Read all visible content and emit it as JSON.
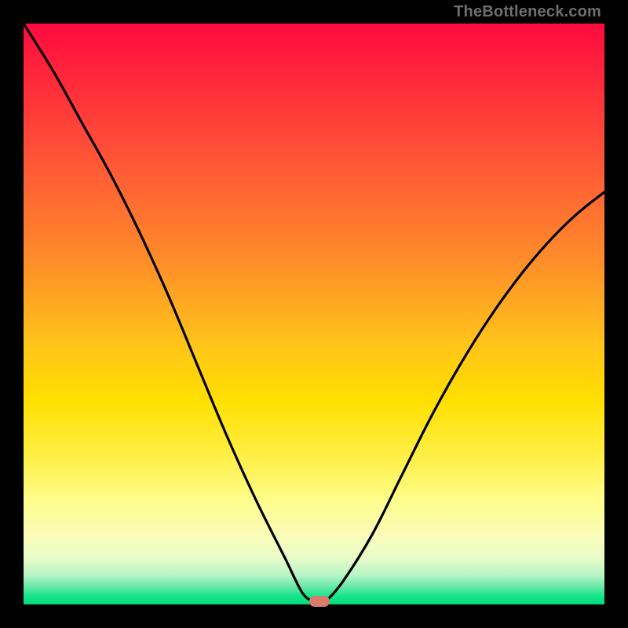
{
  "watermark": "TheBottleneck.com",
  "colors": {
    "frame_bg": "#000000",
    "gradient_top": "#ff0a40",
    "gradient_mid": "#ffe000",
    "gradient_bottom": "#00db7a",
    "curve": "#000000",
    "min_marker": "#d77b6a"
  },
  "chart_data": {
    "type": "line",
    "title": "",
    "xlabel": "",
    "ylabel": "",
    "xlim": [
      0,
      100
    ],
    "ylim": [
      0,
      100
    ],
    "grid": false,
    "legend": false,
    "series": [
      {
        "name": "bottleneck-curve",
        "x": [
          0,
          5,
          10,
          15,
          20,
          25,
          30,
          35,
          40,
          45,
          48,
          50,
          51,
          52,
          55,
          60,
          65,
          70,
          75,
          80,
          85,
          90,
          95,
          100
        ],
        "values": [
          100,
          92,
          83,
          74,
          64,
          53,
          41,
          29,
          18,
          8,
          2,
          0.5,
          0,
          0.5,
          4,
          12,
          22,
          32,
          41,
          49,
          56,
          62,
          67,
          71
        ]
      }
    ],
    "min_point": {
      "x": 51,
      "y": 0
    },
    "annotations": []
  }
}
